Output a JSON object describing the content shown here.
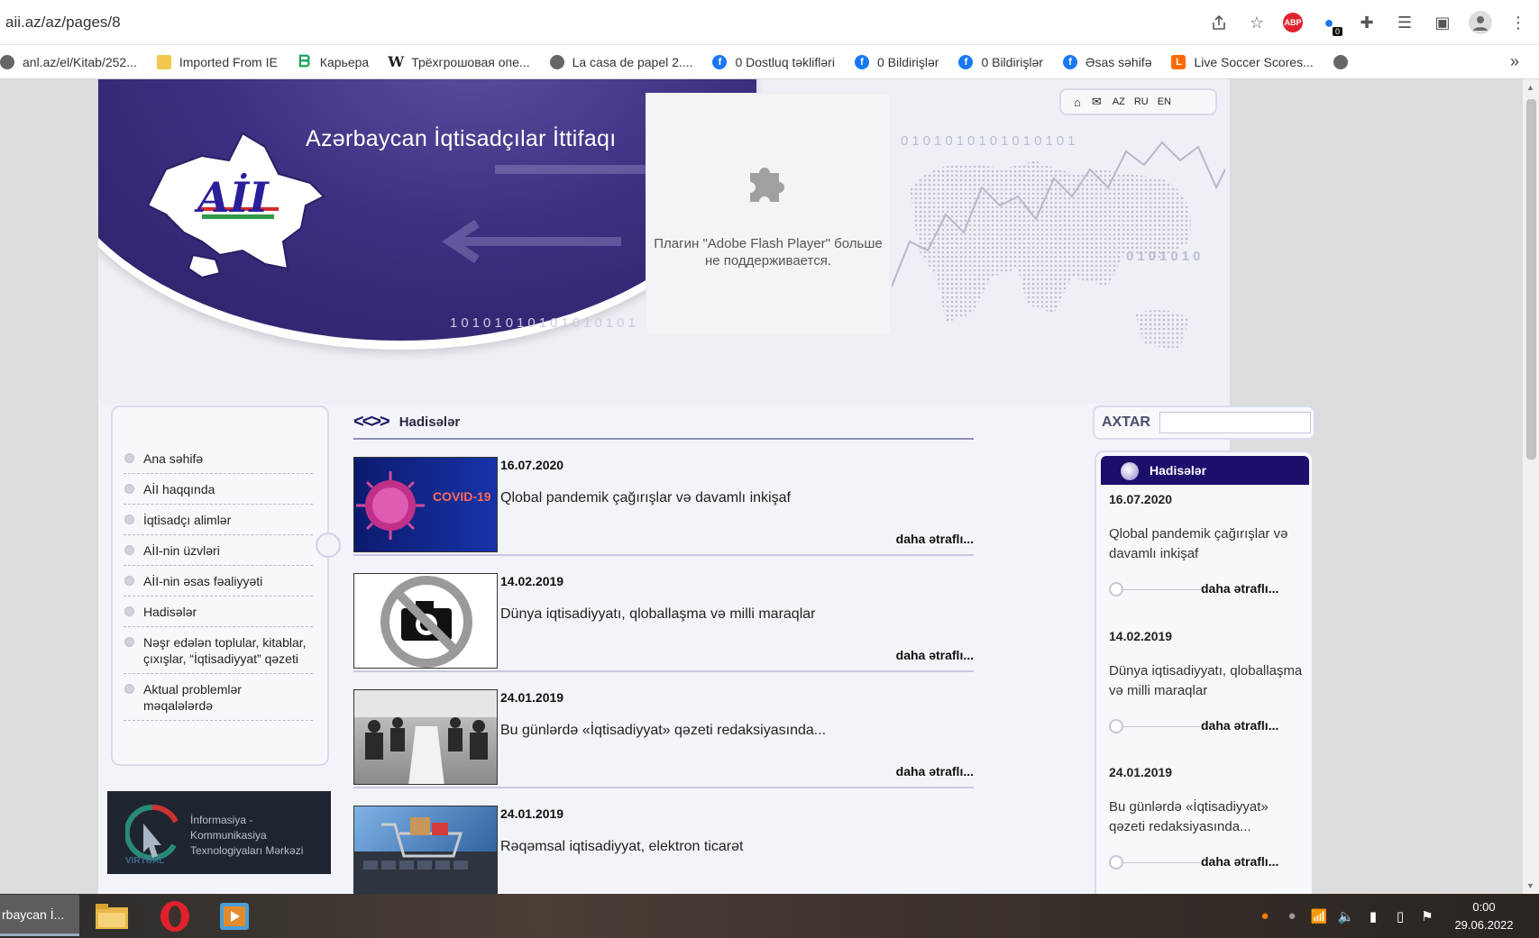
{
  "browser": {
    "url": "aii.az/az/pages/8",
    "bookmarks": [
      {
        "label": "anl.az/el/Kitab/252...",
        "icon": "globe-icon"
      },
      {
        "label": "Imported From IE",
        "icon": "folder-icon"
      },
      {
        "label": "Карьера",
        "icon": "b-logo-icon"
      },
      {
        "label": "Трёхгрошовая опе...",
        "icon": "wikipedia-icon"
      },
      {
        "label": "La casa de papel 2....",
        "icon": "globe-icon"
      },
      {
        "label": "0 Dostluq təklifləri",
        "icon": "facebook-icon"
      },
      {
        "label": "0 Bildirişlər",
        "icon": "facebook-icon"
      },
      {
        "label": "0 Bildirişlər",
        "icon": "facebook-icon"
      },
      {
        "label": "Əsas səhifə",
        "icon": "facebook-icon"
      },
      {
        "label": "Live Soccer Scores...",
        "icon": "livescore-icon"
      }
    ],
    "more_glyph": "»",
    "abp_label": "ABP",
    "ext_badge": "0"
  },
  "header": {
    "site_title": "Azərbaycan İqtisadçılar İttifaqı",
    "logo_letters": "AİI",
    "flash_message": "Плагин \"Adobe Flash Player\" больше не поддерживается.",
    "lang_links": [
      "AZ",
      "RU",
      "EN"
    ],
    "binary_1": "0101010101010101",
    "binary_2": "0101010",
    "binary_3": "10101010101010101"
  },
  "left_nav": {
    "items": [
      "Ana səhifə",
      "AİI haqqında",
      "İqtisadçı alimlər",
      "AİI-nin üzvləri",
      "AİI-nin əsas fəaliyyəti",
      "Hadisələr",
      "Nəşr edələn toplular, kitablar, çıxışlar, “İqtisadiyyat” qəzeti",
      "Aktual problemlər məqalələrdə"
    ]
  },
  "ikt_banner": {
    "line1": "İnformasiya - Kommunikasiya",
    "line2": "Texnologiyaları Mərkəzi",
    "virtual": "VIRTUAL"
  },
  "content": {
    "breadcrumb_glyph": "<<>>",
    "section_title": "Hadisələr",
    "more_label": "daha ətraflı...",
    "covid_label": "COVID-19",
    "news": [
      {
        "date": "16.07.2020",
        "title": "Qlobal pandemik çağırışlar və davamlı inkişaf",
        "image": "covid-virus-image"
      },
      {
        "date": "14.02.2019",
        "title": "Dünya iqtisadiyyatı, qloballaşma və milli maraqlar",
        "image": "no-photo-image"
      },
      {
        "date": "24.01.2019",
        "title": "Bu günlərdə «İqtisadiyyat» qəzeti redaksiyasında...",
        "image": "meeting-photo-image"
      },
      {
        "date": "24.01.2019",
        "title": "Rəqəmsal iqtisadiyyat, elektron ticarət",
        "image": "ecommerce-cart-image"
      }
    ]
  },
  "right_col": {
    "search_label": "AXTAR",
    "news_title": "Hadisələr",
    "more_label": "daha ətraflı...",
    "news": [
      {
        "date": "16.07.2020",
        "title": "Qlobal pandemik çağırışlar və davamlı inkişaf"
      },
      {
        "date": "14.02.2019",
        "title": "Dünya iqtisadiyyatı, qloballaşma və milli maraqlar"
      },
      {
        "date": "24.01.2019",
        "title": "Bu günlərdə «İqtisadiyyat» qəzeti redaksiyasında..."
      }
    ]
  },
  "taskbar": {
    "active_window": "rbaycan İ...",
    "time": "0:00",
    "date": "29.06.2022"
  }
}
